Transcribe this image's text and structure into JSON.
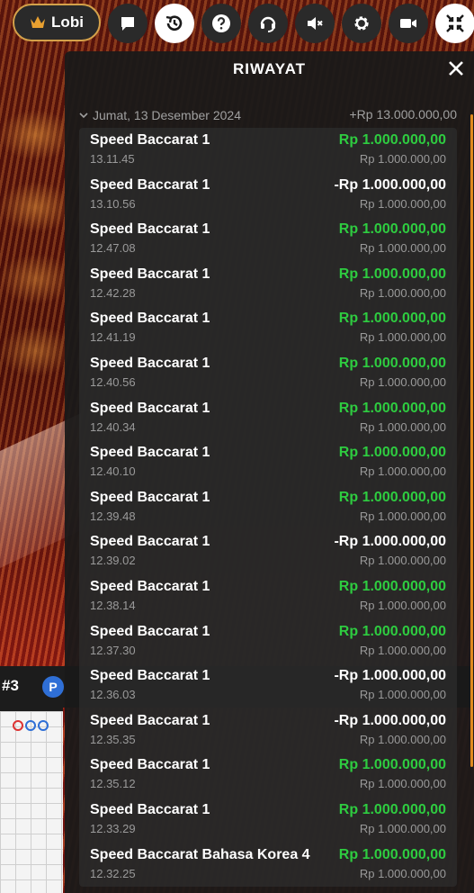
{
  "toolbar": {
    "lobby_label": "Lobi",
    "icons": [
      "chat-icon",
      "history-icon",
      "help-icon",
      "support-headset-icon",
      "mute-icon",
      "settings-icon",
      "video-icon",
      "exit-fullscreen-icon"
    ]
  },
  "background": {
    "shoe_label": "#3",
    "player_badge": "P"
  },
  "panel": {
    "title": "RIWAYAT",
    "date": "Jumat, 13 Desember 2024",
    "day_total": "+Rp 13.000.000,00",
    "items": [
      {
        "game": "Speed Baccarat 1",
        "time": "13.11.45",
        "result": "Rp 1.000.000,00",
        "stake": "Rp 1.000.000,00",
        "win": true
      },
      {
        "game": "Speed Baccarat 1",
        "time": "13.10.56",
        "result": "-Rp 1.000.000,00",
        "stake": "Rp 1.000.000,00",
        "win": false
      },
      {
        "game": "Speed Baccarat 1",
        "time": "12.47.08",
        "result": "Rp 1.000.000,00",
        "stake": "Rp 1.000.000,00",
        "win": true
      },
      {
        "game": "Speed Baccarat 1",
        "time": "12.42.28",
        "result": "Rp 1.000.000,00",
        "stake": "Rp 1.000.000,00",
        "win": true
      },
      {
        "game": "Speed Baccarat 1",
        "time": "12.41.19",
        "result": "Rp 1.000.000,00",
        "stake": "Rp 1.000.000,00",
        "win": true
      },
      {
        "game": "Speed Baccarat 1",
        "time": "12.40.56",
        "result": "Rp 1.000.000,00",
        "stake": "Rp 1.000.000,00",
        "win": true
      },
      {
        "game": "Speed Baccarat 1",
        "time": "12.40.34",
        "result": "Rp 1.000.000,00",
        "stake": "Rp 1.000.000,00",
        "win": true
      },
      {
        "game": "Speed Baccarat 1",
        "time": "12.40.10",
        "result": "Rp 1.000.000,00",
        "stake": "Rp 1.000.000,00",
        "win": true
      },
      {
        "game": "Speed Baccarat 1",
        "time": "12.39.48",
        "result": "Rp 1.000.000,00",
        "stake": "Rp 1.000.000,00",
        "win": true
      },
      {
        "game": "Speed Baccarat 1",
        "time": "12.39.02",
        "result": "-Rp 1.000.000,00",
        "stake": "Rp 1.000.000,00",
        "win": false
      },
      {
        "game": "Speed Baccarat 1",
        "time": "12.38.14",
        "result": "Rp 1.000.000,00",
        "stake": "Rp 1.000.000,00",
        "win": true
      },
      {
        "game": "Speed Baccarat 1",
        "time": "12.37.30",
        "result": "Rp 1.000.000,00",
        "stake": "Rp 1.000.000,00",
        "win": true
      },
      {
        "game": "Speed Baccarat 1",
        "time": "12.36.03",
        "result": "-Rp 1.000.000,00",
        "stake": "Rp 1.000.000,00",
        "win": false
      },
      {
        "game": "Speed Baccarat 1",
        "time": "12.35.35",
        "result": "-Rp 1.000.000,00",
        "stake": "Rp 1.000.000,00",
        "win": false
      },
      {
        "game": "Speed Baccarat 1",
        "time": "12.35.12",
        "result": "Rp 1.000.000,00",
        "stake": "Rp 1.000.000,00",
        "win": true
      },
      {
        "game": "Speed Baccarat 1",
        "time": "12.33.29",
        "result": "Rp 1.000.000,00",
        "stake": "Rp 1.000.000,00",
        "win": true
      },
      {
        "game": "Speed Baccarat Bahasa Korea 4",
        "time": "12.32.25",
        "result": "Rp 1.000.000,00",
        "stake": "Rp 1.000.000,00",
        "win": true
      }
    ]
  },
  "colors": {
    "win": "#2ecc40",
    "accent": "#e08a1e",
    "lobby_border": "#d4a14a"
  }
}
